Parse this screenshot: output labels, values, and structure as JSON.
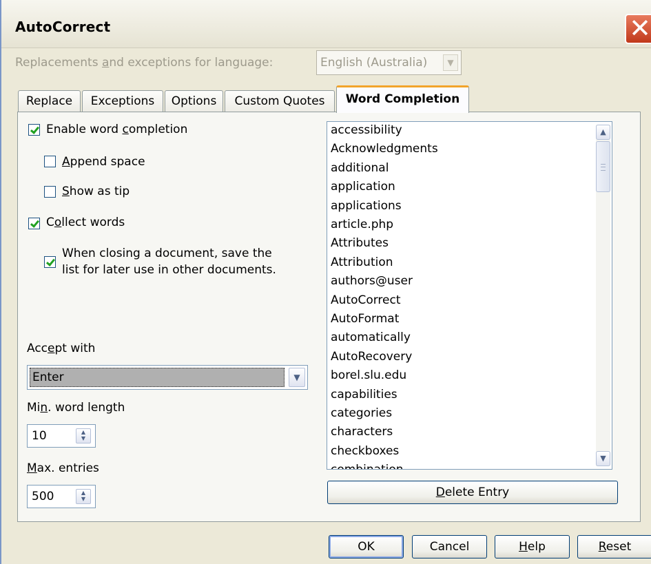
{
  "window": {
    "title": "AutoCorrect",
    "close_glyph": "✕"
  },
  "language": {
    "label": "Replacements and exceptions for language:",
    "value": "English (Australia)"
  },
  "tabs": [
    {
      "label": "Replace"
    },
    {
      "label": "Exceptions"
    },
    {
      "label": "Options"
    },
    {
      "label": "Custom Quotes"
    },
    {
      "label": "Word Completion",
      "active": true
    }
  ],
  "options": {
    "enable_completion": {
      "label": "Enable word completion",
      "checked": true
    },
    "append_space": {
      "label": "Append space",
      "checked": false
    },
    "show_as_tip": {
      "label": "Show as tip",
      "checked": false
    },
    "collect_words": {
      "label": "Collect words",
      "checked": true
    },
    "save_list_line1": "When closing a document, save the",
    "save_list_line2": "list for later use in other documents.",
    "save_list_checked": true
  },
  "accept_with": {
    "label": "Accept with",
    "value": "Enter"
  },
  "min_word_length": {
    "label": "Min. word length",
    "value": "10"
  },
  "max_entries": {
    "label": "Max. entries",
    "value": "500"
  },
  "word_list": [
    "accessibility",
    "Acknowledgments",
    "additional",
    "application",
    "applications",
    "article.php",
    "Attributes",
    "Attribution",
    "authors@user",
    "AutoCorrect",
    "AutoFormat",
    "automatically",
    "AutoRecovery",
    "borel.slu.edu",
    "capabilities",
    "categories",
    "characters",
    "checkboxes",
    "combination"
  ],
  "buttons": {
    "delete_entry": "Delete Entry",
    "ok": "OK",
    "cancel": "Cancel",
    "help": "Help",
    "reset": "Reset"
  },
  "icons": {
    "close": "close-icon",
    "dropdown": "chevron-down-icon",
    "scroll_up": "scroll-up-icon",
    "scroll_down": "scroll-down-icon",
    "spin": "spin-arrows-icon"
  }
}
